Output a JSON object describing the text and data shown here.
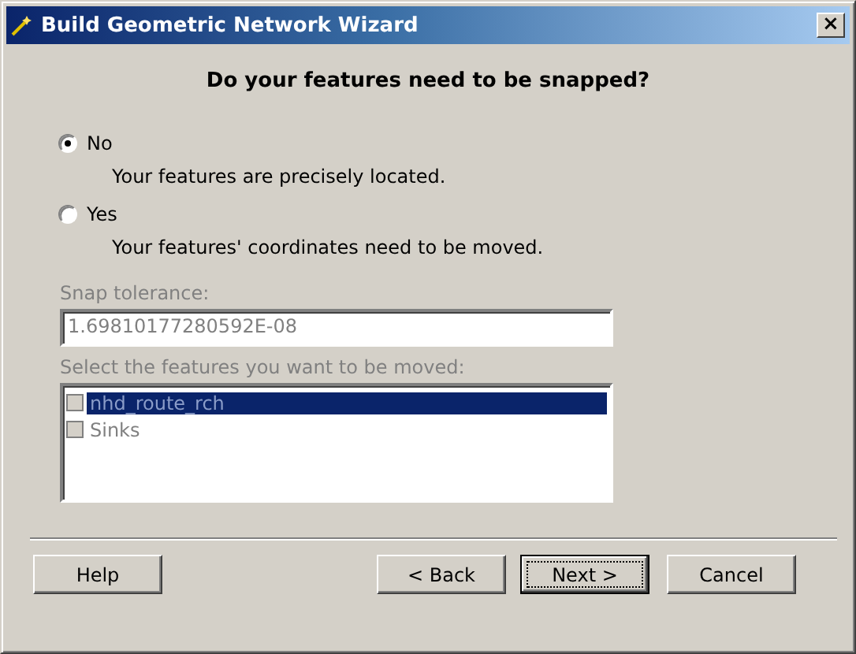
{
  "window": {
    "title": "Build Geometric Network Wizard",
    "close": "×"
  },
  "heading": "Do your features need to be snapped?",
  "options": [
    {
      "label": "No",
      "description": "Your features are precisely located.",
      "selected": true
    },
    {
      "label": "Yes",
      "description": "Your features' coordinates need to be moved.",
      "selected": false
    }
  ],
  "snap_tolerance": {
    "label": "Snap tolerance:",
    "value": "1.69810177280592E-08",
    "disabled": true
  },
  "features": {
    "label": "Select the features you want to be moved:",
    "disabled": true,
    "items": [
      {
        "label": "nhd_route_rch",
        "checked": false,
        "selected": true
      },
      {
        "label": "Sinks",
        "checked": false,
        "selected": false
      }
    ]
  },
  "buttons": [
    {
      "label": "Help",
      "default": false
    },
    {
      "label": "< Back",
      "default": false
    },
    {
      "label": "Next >",
      "default": true
    },
    {
      "label": "Cancel",
      "default": false
    }
  ]
}
